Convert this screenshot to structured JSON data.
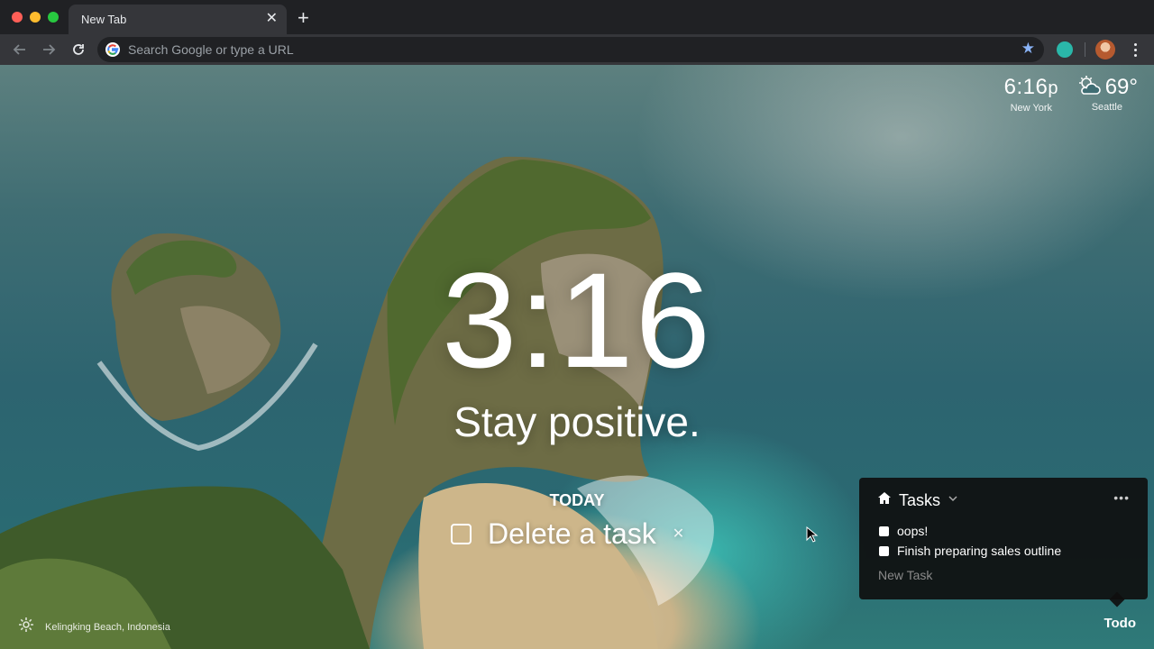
{
  "browser": {
    "tab_title": "New Tab",
    "tab_close": "✕",
    "new_tab": "+",
    "omnibox_placeholder": "Search Google or type a URL"
  },
  "dashboard": {
    "top_clock": {
      "time": "6:16",
      "suffix": "p",
      "location": "New York"
    },
    "weather": {
      "icon": "partly-cloudy-icon",
      "temperature": "69°",
      "location": "Seattle"
    },
    "main_clock": "3:16",
    "mantra": "Stay positive.",
    "focus": {
      "label": "TODAY",
      "task": "Delete a task",
      "close": "✕"
    },
    "background_location": "Kelingking Beach, Indonesia",
    "todo_link": "Todo"
  },
  "todo_panel": {
    "title": "Tasks",
    "more": "•••",
    "items": [
      {
        "label": "oops!"
      },
      {
        "label": "Finish preparing sales outline"
      }
    ],
    "new_task_placeholder": "New Task"
  },
  "colors": {
    "chrome_dark": "#202124",
    "chrome_toolbar": "#35363a",
    "accent_star": "#8ab4f8",
    "extension": "#2ab7a9"
  }
}
